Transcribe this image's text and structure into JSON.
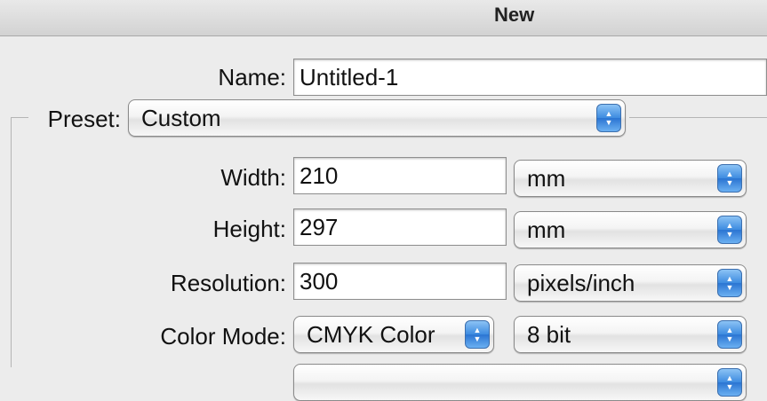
{
  "window": {
    "title": "New"
  },
  "name": {
    "label": "Name:",
    "value": "Untitled-1"
  },
  "preset": {
    "label": "Preset:",
    "value": "Custom"
  },
  "width": {
    "label": "Width:",
    "value": "210",
    "unit": "mm"
  },
  "height": {
    "label": "Height:",
    "value": "297",
    "unit": "mm"
  },
  "resolution": {
    "label": "Resolution:",
    "value": "300",
    "unit": "pixels/inch"
  },
  "color_mode": {
    "label": "Color Mode:",
    "mode": "CMYK Color",
    "depth": "8 bit"
  },
  "icons": {
    "stepper": "up-down-arrows-icon"
  }
}
